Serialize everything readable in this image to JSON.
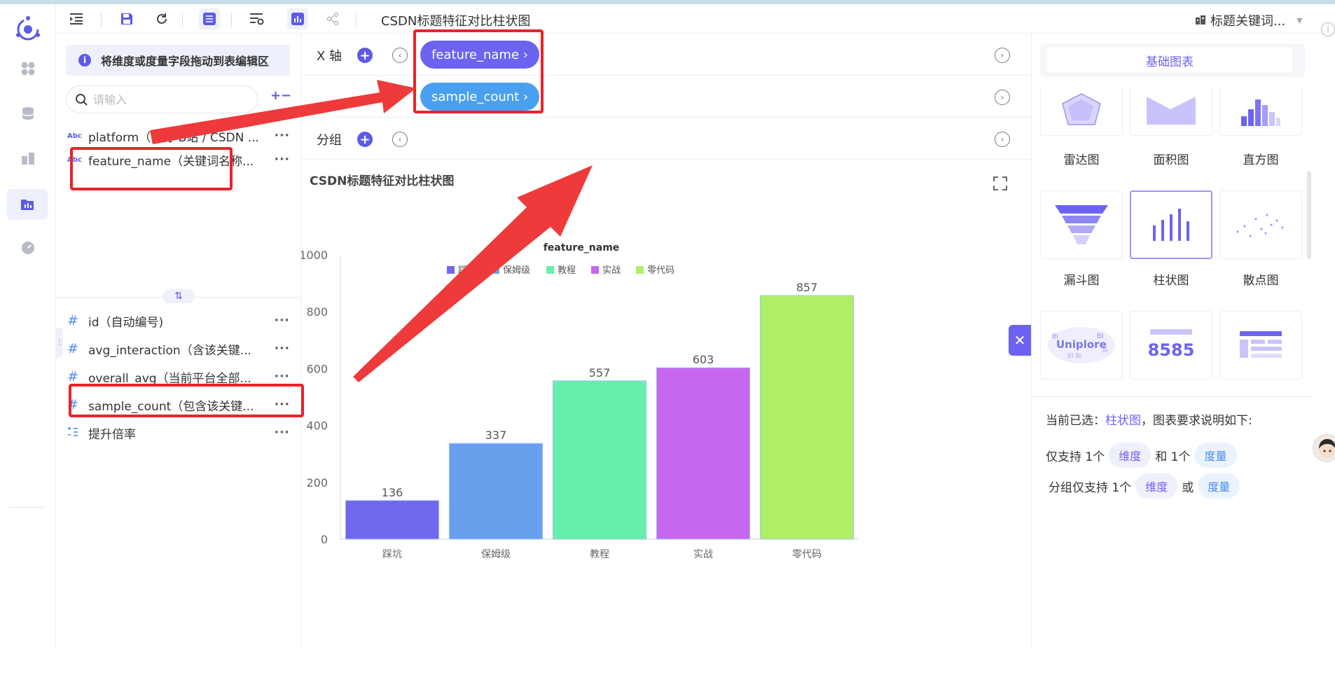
{
  "toolbar": {
    "doc_title": "CSDN标题特征对比柱状图",
    "dataset_title": "标题关键词...",
    "buttons": [
      "indent-icon",
      "save-icon",
      "refresh-icon",
      "table-view-icon",
      "filter-settings-icon",
      "chart-view-icon",
      "share-icon"
    ]
  },
  "rail": {
    "items": [
      "grid-icon",
      "database-icon",
      "dashboard-icon",
      "folder-chart-icon",
      "gauge-icon"
    ]
  },
  "left_panel": {
    "tip": "将维度或度量字段拖动到表编辑区",
    "search_placeholder": "请输入",
    "dimensions": [
      {
        "type": "Abc",
        "label": "platform（区分 B站 / CSDN ..."
      },
      {
        "type": "Abc",
        "label": "feature_name（关键词名称..."
      }
    ],
    "measures": [
      {
        "type": "#",
        "label": "id（自动编号)"
      },
      {
        "type": "#",
        "label": "avg_interaction（含该关键..."
      },
      {
        "type": "#",
        "label": "overall_avg（当前平台全部..."
      },
      {
        "type": "#",
        "label": "sample_count（包含该关键..."
      },
      {
        "type": "calc",
        "label": "提升倍率"
      }
    ]
  },
  "shelves": {
    "x_axis_label": "X 轴",
    "x_pill": "feature_name ›",
    "y_pill": "sample_count ›",
    "group_label": "分组"
  },
  "chart_data": {
    "type": "bar",
    "title": "CSDN标题特征对比柱状图",
    "legend_title": "feature_name",
    "categories": [
      "踩坑",
      "保姆级",
      "教程",
      "实战",
      "零代码"
    ],
    "values": [
      136,
      337,
      557,
      603,
      857
    ],
    "colors": [
      "#7167ee",
      "#68a0ee",
      "#66efaa",
      "#c767ee",
      "#aeef66"
    ],
    "ylim": [
      0,
      1000
    ],
    "yticks": [
      0,
      200,
      400,
      600,
      800,
      1000
    ],
    "legend_position": "top-center"
  },
  "right_panel": {
    "tab": "基础图表",
    "charts": [
      {
        "label": "雷达图"
      },
      {
        "label": "面积图"
      },
      {
        "label": "直方图"
      },
      {
        "label": "漏斗图"
      },
      {
        "label": "柱状图"
      },
      {
        "label": "散点图"
      },
      {
        "label": "wordcloud"
      },
      {
        "label": "8585"
      },
      {
        "label": "table"
      }
    ],
    "selected_prefix": "当前已选：",
    "selected_chart": "柱状图",
    "selected_suffix": "，图表要求说明如下:",
    "req1_a": "仅支持 1个",
    "req1_b": "和 1个",
    "req2_a": "分组仅支持 1个",
    "req2_b": "或",
    "dim_tag": "维度",
    "mea_tag": "度量",
    "kpi_text": "8585"
  }
}
